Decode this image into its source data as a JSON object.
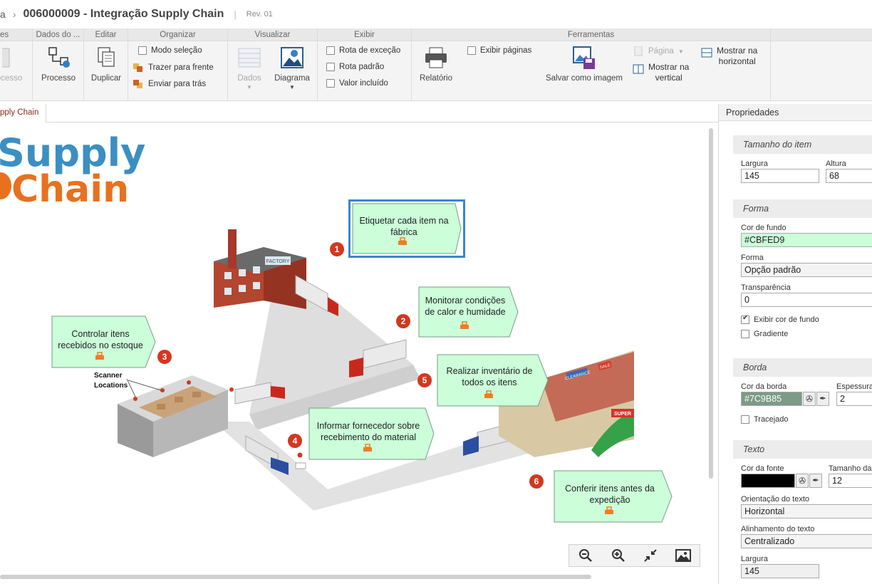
{
  "title": {
    "crumb": "a",
    "doc_title": "006000009 - Integração Supply Chain",
    "rev": "Rev. 01"
  },
  "ribbon": {
    "groups": [
      "es",
      "Dados do ...",
      "Editar",
      "Organizar",
      "Visualizar",
      "Exibir",
      "Ferramentas"
    ],
    "processo_partial": "ocesso",
    "processo": "Processo",
    "duplicar": "Duplicar",
    "modo_selecao": "Modo seleção",
    "trazer_frente": "Trazer para frente",
    "enviar_tras": "Enviar para trás",
    "dados": "Dados",
    "diagrama": "Diagrama",
    "rota_excecao": "Rota de exceção",
    "rota_padrao": "Rota padrão",
    "valor_incluido": "Valor incluído",
    "relatorio": "Relatório",
    "exibir_paginas": "Exibir páginas",
    "salvar_imagem": "Salvar como imagem",
    "pagina": "Página",
    "mostrar_vertical_1": "Mostrar na",
    "mostrar_vertical_2": "vertical",
    "mostrar_horizontal_1": "Mostrar na",
    "mostrar_horizontal_2": "horizontal"
  },
  "tab": {
    "label": "pply Chain"
  },
  "diagram": {
    "logo_line1": "Supply",
    "logo_line2": "Chain",
    "factory_sign": "FACTORY",
    "scanner_1": "Scanner",
    "scanner_2": "Locations",
    "clearance": "CLEARANCE",
    "sale": "SALE",
    "super": "SUPER",
    "callouts": [
      {
        "num": "1",
        "text": "Etiquetar cada item na fábrica"
      },
      {
        "num": "2",
        "text": "Monitorar condições de calor e humidade"
      },
      {
        "num": "3",
        "text": "Controlar itens recebidos no estoque"
      },
      {
        "num": "4",
        "text": "Informar fornecedor sobre recebimento do material"
      },
      {
        "num": "5",
        "text": "Realizar inventário de todos os itens"
      },
      {
        "num": "6",
        "text": "Conferir itens antes da expedição"
      }
    ]
  },
  "props": {
    "header": "Propriedades",
    "sec_tamanho": "Tamanho do item",
    "largura_label": "Largura",
    "largura": "145",
    "altura_label": "Altura",
    "altura": "68",
    "sec_forma": "Forma",
    "cor_fundo_label": "Cor de fundo",
    "cor_fundo": "#CBFED9",
    "forma_label": "Forma",
    "forma": "Opção padrão",
    "transp_label": "Transparência",
    "transp": "0",
    "exibir_cor": "Exibir cor de fundo",
    "gradiente": "Gradiente",
    "sec_borda": "Borda",
    "cor_borda_label": "Cor da borda",
    "cor_borda": "#7C9B85",
    "espessura_label": "Espessura",
    "espessura": "2",
    "tracejado": "Tracejado",
    "sec_texto": "Texto",
    "cor_fonte_label": "Cor da fonte",
    "tamanho_fonte_label": "Tamanho da",
    "tamanho_fonte": "12",
    "orient_label": "Orientação do texto",
    "orient": "Horizontal",
    "alin_label": "Alinhamento do texto",
    "alin": "Centralizado",
    "largura2_label": "Largura",
    "largura2": "145"
  },
  "colors": {
    "callout_fill": "#CBFED9",
    "callout_border": "#7C9B85",
    "selection": "#3a86d0",
    "badge": "#d2381f",
    "logo_blue": "#3c8fc2",
    "logo_orange": "#e8711e"
  }
}
